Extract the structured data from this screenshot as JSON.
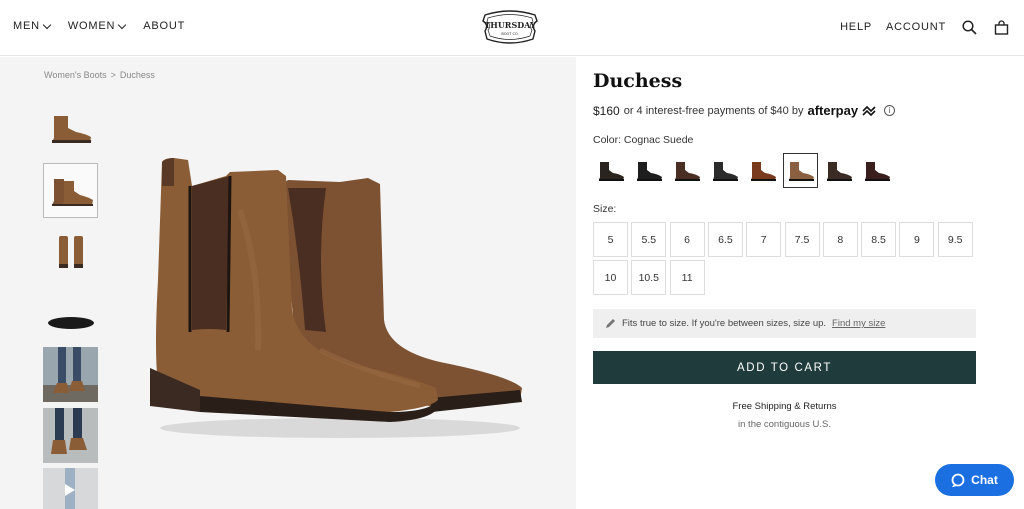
{
  "nav": {
    "left": [
      {
        "label": "MEN",
        "dropdown": true
      },
      {
        "label": "WOMEN",
        "dropdown": true
      },
      {
        "label": "ABOUT",
        "dropdown": false
      }
    ],
    "logo_text_top": "THURSDAY",
    "logo_text_bottom": "BOOT CO.",
    "right": [
      {
        "label": "HELP"
      },
      {
        "label": "ACCOUNT"
      }
    ],
    "icons": [
      "search-icon",
      "bag-icon"
    ]
  },
  "breadcrumb": {
    "parent": "Women's Boots",
    "separator": ">",
    "current": "Duchess"
  },
  "product": {
    "title": "Duchess",
    "price": "$160",
    "installment_text": "or 4 interest-free payments of $40 by",
    "afterpay_label": "afterpay",
    "color_label": "Color: Cognac Suede",
    "size_label": "Size:",
    "sizes": [
      "5",
      "5.5",
      "6",
      "6.5",
      "7",
      "7.5",
      "8",
      "8.5",
      "9",
      "9.5",
      "10",
      "10.5",
      "11"
    ],
    "fit_text": "Fits true to size. If you're between sizes, size up.",
    "fit_link": "Find my size",
    "add_to_cart": "ADD TO CART",
    "shipping_title": "Free Shipping & Returns",
    "shipping_sub": "in the contiguous U.S."
  },
  "swatch_colors": [
    "#2a2420",
    "#1e1e1e",
    "#4a2e24",
    "#2b2b2b",
    "#7a3a1e",
    "#8a6040",
    "#3a2c24",
    "#3a1e1e"
  ],
  "selected_swatch_index": 5,
  "thumbnail_count": 7,
  "chat": {
    "label": "Chat"
  },
  "colors": {
    "accent": "#1f3b3b",
    "chat": "#1b6fe0",
    "suede": "#8a5d36"
  }
}
